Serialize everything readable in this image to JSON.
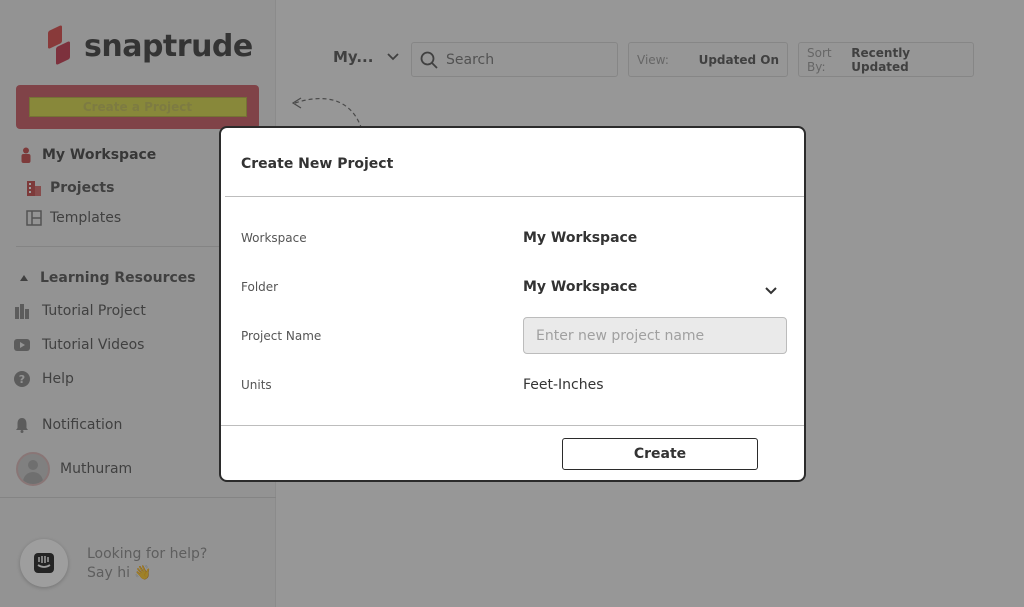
{
  "brand": {
    "name": "snaptrude"
  },
  "sidebar": {
    "create_button": "Create a Project",
    "workspace_section": "My Workspace",
    "items": [
      {
        "label": "Projects",
        "icon": "building-icon"
      },
      {
        "label": "Templates",
        "icon": "template-icon"
      }
    ],
    "learning_section": "Learning Resources",
    "learning_items": [
      {
        "label": "Tutorial Project",
        "icon": "city-icon"
      },
      {
        "label": "Tutorial Videos",
        "icon": "video-icon"
      },
      {
        "label": "Help",
        "icon": "help-icon"
      }
    ],
    "notification": "Notification",
    "user_name": "Muthuram",
    "help_prompt_line1": "Looking for help?",
    "help_prompt_line2": "Say hi 👋"
  },
  "topbar": {
    "workspace_select": "My...",
    "search_placeholder": "Search",
    "view_label": "View:",
    "view_value": "Updated On",
    "sort_label": "Sort By:",
    "sort_value": "Recently Updated"
  },
  "modal": {
    "title": "Create New Project",
    "workspace_label": "Workspace",
    "workspace_value": "My Workspace",
    "folder_label": "Folder",
    "folder_value": "My Workspace",
    "project_name_label": "Project Name",
    "project_name_placeholder": "Enter new project name",
    "units_label": "Units",
    "units_value": "Feet-Inches",
    "create_button": "Create"
  }
}
